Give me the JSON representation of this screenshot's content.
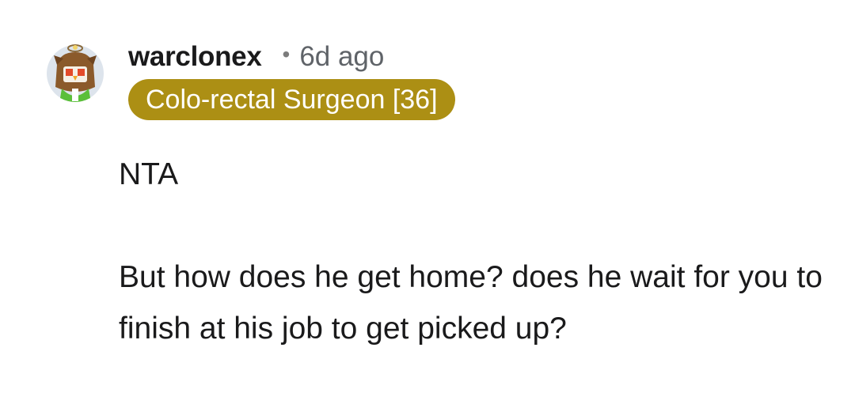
{
  "comment": {
    "avatar_icon": "owl-avatar-icon",
    "username": "warclonex",
    "separator": "•",
    "time_ago": "6d ago",
    "flair": {
      "label": "Colo-rectal Surgeon [36]",
      "color": "#ac8f14",
      "text_color": "#ffffff"
    },
    "body": {
      "paragraph_1": "NTA",
      "paragraph_2": "But how does he get home? does he wait for you to finish at his job to get picked up?"
    }
  }
}
